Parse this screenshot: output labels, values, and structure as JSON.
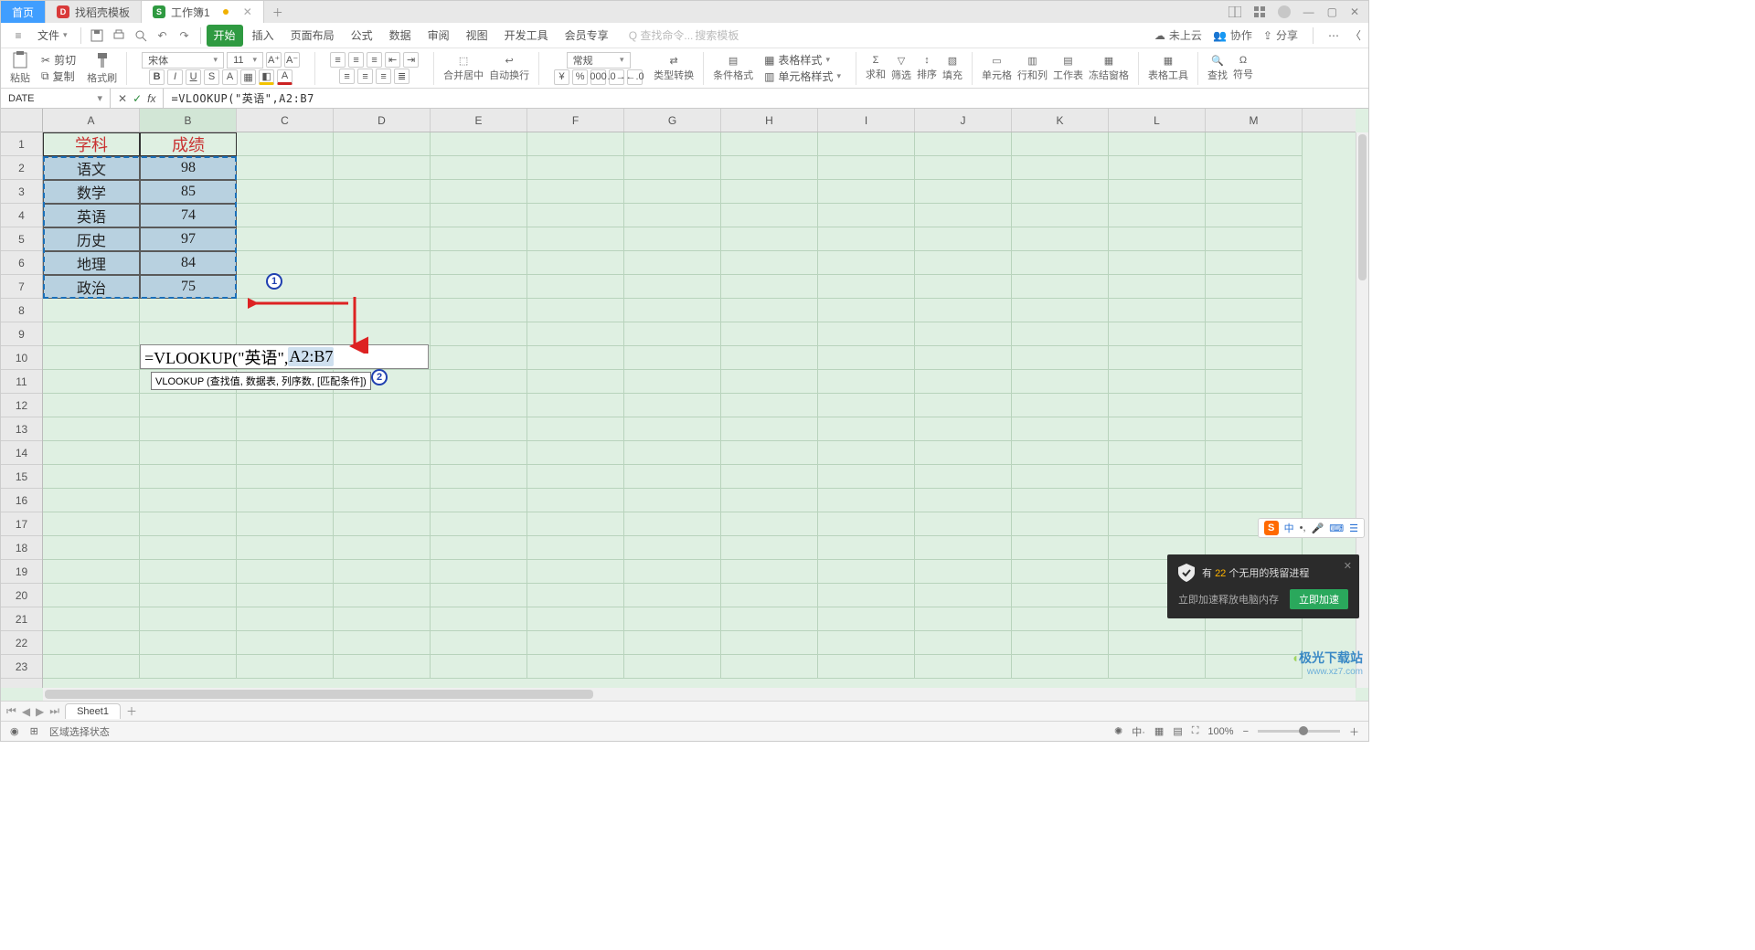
{
  "tabs": {
    "home": "首页",
    "tab1": "找稻壳模板",
    "tab2": "工作簿1"
  },
  "menu": {
    "hamburger": "≡",
    "file": "文件",
    "start": "开始",
    "insert": "插入",
    "page": "页面布局",
    "formula": "公式",
    "data": "数据",
    "review": "审阅",
    "view": "视图",
    "dev": "开发工具",
    "member": "会员专享",
    "search_cmd": "查找命令...",
    "search_tpl": "搜索模板",
    "not_cloud": "未上云",
    "collab": "协作",
    "share": "分享"
  },
  "ribbon": {
    "paste": "粘贴",
    "cut": "剪切",
    "copy": "复制",
    "fmtpainter": "格式刷",
    "font": "宋体",
    "size": "11",
    "merge": "合并居中",
    "wrap": "自动换行",
    "general": "常规",
    "typeconv": "类型转换",
    "cond": "条件格式",
    "tblstyle": "表格样式",
    "cellstyle": "单元格样式",
    "sum": "求和",
    "filter": "筛选",
    "sort": "排序",
    "fill": "填充",
    "cellfmt": "单元格",
    "rowcol": "行和列",
    "sheet": "工作表",
    "freeze": "冻结窗格",
    "tools": "表格工具",
    "find": "查找",
    "symbol": "符号"
  },
  "fxbar": {
    "name": "DATE",
    "fx": "fx",
    "formula": "=VLOOKUP(\"英语\",A2:B7"
  },
  "cols": [
    "A",
    "B",
    "C",
    "D",
    "E",
    "F",
    "G",
    "H",
    "I",
    "J",
    "K",
    "L",
    "M"
  ],
  "rows_nums": [
    "1",
    "2",
    "3",
    "4",
    "5",
    "6",
    "7",
    "8",
    "9",
    "10",
    "11",
    "12",
    "13",
    "14",
    "15",
    "16",
    "17",
    "18",
    "19",
    "20",
    "21",
    "22",
    "23"
  ],
  "table": {
    "h1": "学科",
    "h2": "成绩",
    "r": [
      {
        "a": "语文",
        "b": "98"
      },
      {
        "a": "数学",
        "b": "85"
      },
      {
        "a": "英语",
        "b": "74"
      },
      {
        "a": "历史",
        "b": "97"
      },
      {
        "a": "地理",
        "b": "84"
      },
      {
        "a": "政治",
        "b": "75"
      }
    ]
  },
  "editing_cell": "=VLOOKUP(\"英语\",",
  "editing_sel": "A2:B7",
  "tooltip": "VLOOKUP (查找值, 数据表, 列序数, [匹配条件])",
  "sheet_tab": "Sheet1",
  "status": {
    "mode": "区域选择状态",
    "zoom": "100%"
  },
  "ime": {
    "label1": "中",
    "sep": "▸",
    "mic": "🎤"
  },
  "popup": {
    "title_pre": "有 ",
    "count": "22",
    "title_post": " 个无用的残留进程",
    "sub": "立即加速释放电脑内存",
    "btn": "立即加速"
  },
  "wm": {
    "brand": "极光下载站",
    "url": "www.xz7.com"
  },
  "badges": {
    "one": "1",
    "two": "2"
  }
}
